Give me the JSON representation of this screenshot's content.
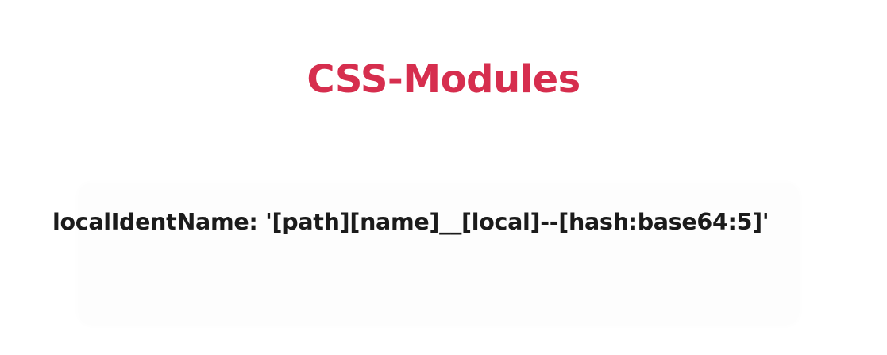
{
  "slide": {
    "title": "CSS-Modules",
    "code_line": "localIdentName: '[path][name]__[local]--[hash:base64:5]'"
  },
  "colors": {
    "title": "#d62e4e",
    "text": "#1b1b1b",
    "background": "#ffffff"
  }
}
